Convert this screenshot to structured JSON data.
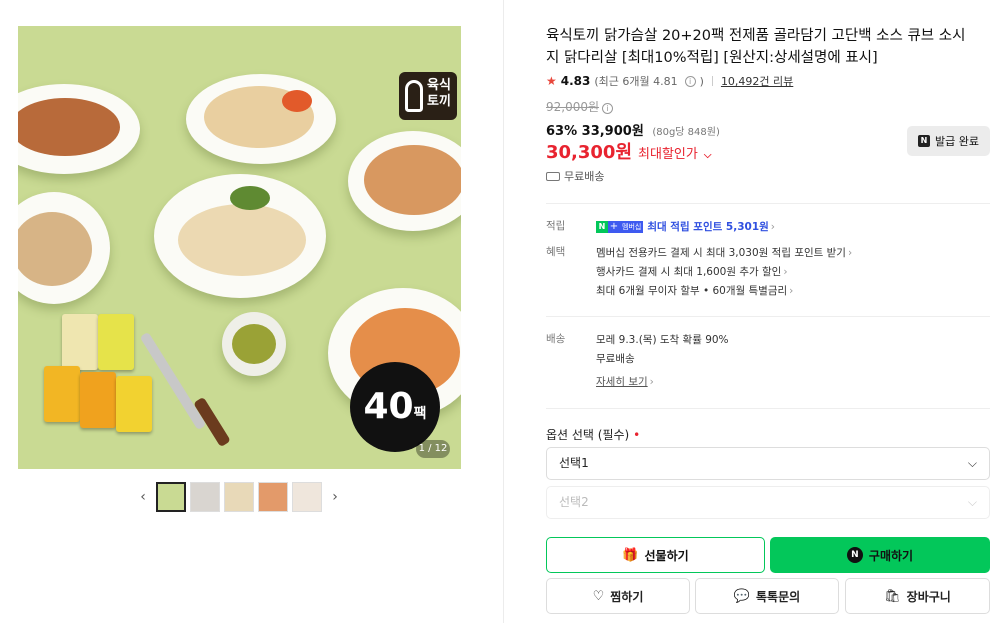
{
  "gallery": {
    "logo_text": "육식\n토끼",
    "pack_count": "40",
    "pack_unit": "팩",
    "counter": "1 / 12",
    "prev_icon": "chevron-left-icon",
    "next_icon": "chevron-right-icon",
    "thumbnail_count": 5
  },
  "product": {
    "title": "육식토끼 닭가슴살 20+20팩 전제품 골라담기 고단백 소스 큐브 소시지 닭다리살 [최대10%적립] [원산지:상세설명에 표시]",
    "rating": "4.83",
    "recent_rating": "(최근 6개월 4.81",
    "review_count": "10,492건 리뷰",
    "original_price": "92,000원",
    "discount_rate": "63%",
    "sale_price": "33,900원",
    "unit_price": "(80g당 848원)",
    "max_discount_price": "30,300원",
    "max_discount_label": "최대할인가",
    "coupon_button": "발급 완료",
    "shipping_free": "무료배송"
  },
  "benefits": {
    "points_key": "적립",
    "points_badge": "멤버십",
    "points_text": "최대 적립 포인트 5,301원",
    "benefit_key": "혜택",
    "benefit_lines": [
      "멤버십 전용카드 결제 시 최대 3,030원 적립 포인트 받기",
      "행사카드 결제 시 최대 1,600원 추가 할인",
      "최대 6개월 무이자 할부 • 60개월 특별금리"
    ],
    "delivery_key": "배송",
    "delivery_lines": [
      "모레 9.3.(목) 도착 확률 90%",
      "무료배송"
    ],
    "delivery_detail": "자세히 보기"
  },
  "options": {
    "label": "옵션 선택 (필수)",
    "required_mark": "•",
    "select1": "선택1",
    "select2": "선택2"
  },
  "actions": {
    "gift": "선물하기",
    "buy": "구매하기",
    "wish": "찜하기",
    "talk": "톡톡문의",
    "cart": "장바구니"
  },
  "colors": {
    "accent_green": "#03c75a",
    "price_red": "#e8232f",
    "hero_bg": "#c9da93"
  }
}
